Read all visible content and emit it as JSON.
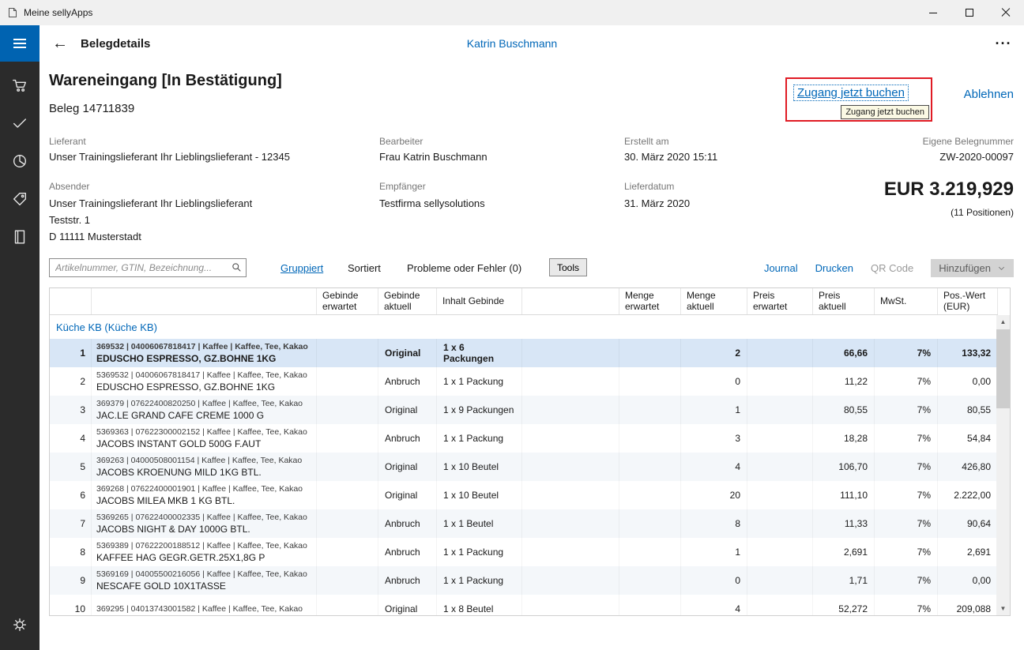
{
  "colors": {
    "accent_blue": "#0067b8",
    "hamburger_bg": "#0063b1",
    "sidebar_bg": "#2b2b2b",
    "selected_row_bg": "#d8e6f6",
    "highlight_border_red": "#e01b24"
  },
  "window": {
    "title": "Meine sellyApps"
  },
  "icons": {
    "back": "←",
    "more": "···",
    "scroll_up": "▲",
    "scroll_down": "▼"
  },
  "header": {
    "title": "Belegdetails",
    "user": "Katrin Buschmann"
  },
  "document": {
    "status_title": "Wareneingang [In Bestätigung]",
    "beleg": "Beleg 14711839",
    "actions": {
      "book_now": "Zugang jetzt buchen",
      "book_now_tooltip": "Zugang jetzt buchen",
      "reject": "Ablehnen"
    },
    "info": {
      "lieferant_label": "Lieferant",
      "lieferant": "Unser Trainingslieferant Ihr Lieblingslieferant - 12345",
      "bearbeiter_label": "Bearbeiter",
      "bearbeiter": "Frau Katrin Buschmann",
      "erstellt_label": "Erstellt am",
      "erstellt": "30. März 2020 15:11",
      "belegnummer_label": "Eigene Belegnummer",
      "belegnummer": "ZW-2020-00097",
      "absender_label": "Absender",
      "absender_lines": [
        "Unser Trainingslieferant Ihr Lieblingslieferant",
        "Teststr. 1",
        "D 11111 Musterstadt"
      ],
      "empfaenger_label": "Empfänger",
      "empfaenger": "Testfirma sellysolutions",
      "lieferdatum_label": "Lieferdatum",
      "lieferdatum": "31. März 2020"
    },
    "total": {
      "amount": "EUR 3.219,929",
      "positions": "(11 Positionen)"
    }
  },
  "toolbar": {
    "search_placeholder": "Artikelnummer, GTIN, Bezeichnung...",
    "grouped": "Gruppiert",
    "sorted": "Sortiert",
    "problems": "Probleme oder Fehler (0)",
    "tools": "Tools",
    "journal": "Journal",
    "print": "Drucken",
    "qr_code": "QR Code",
    "add": "Hinzufügen"
  },
  "table": {
    "headers": [
      "",
      "",
      "Gebinde erwartet",
      "Gebinde aktuell",
      "Inhalt Gebinde",
      "",
      "Menge erwartet",
      "Menge aktuell",
      "Preis erwartet",
      "Preis aktuell",
      "MwSt.",
      "Pos.-Wert (EUR)"
    ],
    "group": "Küche KB (Küche KB)",
    "rows": [
      {
        "num": "1",
        "meta": "369532 | 04006067818417 | Kaffee | Kaffee, Tee, Kakao",
        "name": "EDUSCHO ESPRESSO, GZ.BOHNE 1KG",
        "gebinde_aktuell": "Original",
        "inhalt": "1 x 6 Packungen",
        "menge_aktuell": "2",
        "preis_aktuell": "66,66",
        "mwst": "7%",
        "wert": "133,32",
        "selected": true
      },
      {
        "num": "2",
        "meta": "5369532 | 04006067818417 | Kaffee | Kaffee, Tee, Kakao",
        "name": "EDUSCHO ESPRESSO, GZ.BOHNE 1KG",
        "gebinde_aktuell": "Anbruch",
        "inhalt": "1 x 1 Packung",
        "menge_aktuell": "0",
        "preis_aktuell": "11,22",
        "mwst": "7%",
        "wert": "0,00"
      },
      {
        "num": "3",
        "meta": "369379 | 07622400820250 | Kaffee | Kaffee, Tee, Kakao",
        "name": "JAC.LE GRAND CAFE CREME 1000 G",
        "gebinde_aktuell": "Original",
        "inhalt": "1 x 9 Packungen",
        "menge_aktuell": "1",
        "preis_aktuell": "80,55",
        "mwst": "7%",
        "wert": "80,55"
      },
      {
        "num": "4",
        "meta": "5369363 | 07622300002152 | Kaffee | Kaffee, Tee, Kakao",
        "name": "JACOBS INSTANT GOLD 500G F.AUT",
        "gebinde_aktuell": "Anbruch",
        "inhalt": "1 x 1 Packung",
        "menge_aktuell": "3",
        "preis_aktuell": "18,28",
        "mwst": "7%",
        "wert": "54,84"
      },
      {
        "num": "5",
        "meta": "369263 | 04000508001154 | Kaffee | Kaffee, Tee, Kakao",
        "name": "JACOBS KROENUNG MILD 1KG BTL.",
        "gebinde_aktuell": "Original",
        "inhalt": "1 x 10 Beutel",
        "menge_aktuell": "4",
        "preis_aktuell": "106,70",
        "mwst": "7%",
        "wert": "426,80"
      },
      {
        "num": "6",
        "meta": "369268 | 07622400001901 | Kaffee | Kaffee, Tee, Kakao",
        "name": "JACOBS MILEA MKB 1 KG BTL.",
        "gebinde_aktuell": "Original",
        "inhalt": "1 x 10 Beutel",
        "menge_aktuell": "20",
        "preis_aktuell": "111,10",
        "mwst": "7%",
        "wert": "2.222,00"
      },
      {
        "num": "7",
        "meta": "5369265 | 07622400002335 | Kaffee | Kaffee, Tee, Kakao",
        "name": "JACOBS NIGHT & DAY 1000G BTL.",
        "gebinde_aktuell": "Anbruch",
        "inhalt": "1 x 1 Beutel",
        "menge_aktuell": "8",
        "preis_aktuell": "11,33",
        "mwst": "7%",
        "wert": "90,64"
      },
      {
        "num": "8",
        "meta": "5369389 | 07622200188512 | Kaffee | Kaffee, Tee, Kakao",
        "name": "KAFFEE HAG GEGR.GETR.25X1,8G P",
        "gebinde_aktuell": "Anbruch",
        "inhalt": "1 x 1 Packung",
        "menge_aktuell": "1",
        "preis_aktuell": "2,691",
        "mwst": "7%",
        "wert": "2,691"
      },
      {
        "num": "9",
        "meta": "5369169 | 04005500216056 | Kaffee | Kaffee, Tee, Kakao",
        "name": "NESCAFE GOLD 10X1TASSE",
        "gebinde_aktuell": "Anbruch",
        "inhalt": "1 x 1 Packung",
        "menge_aktuell": "0",
        "preis_aktuell": "1,71",
        "mwst": "7%",
        "wert": "0,00"
      },
      {
        "num": "10",
        "meta": "369295 | 04013743001582 | Kaffee | Kaffee, Tee, Kakao",
        "name": "",
        "gebinde_aktuell": "Original",
        "inhalt": "1 x 8 Beutel",
        "menge_aktuell": "4",
        "preis_aktuell": "52,272",
        "mwst": "7%",
        "wert": "209,088"
      }
    ]
  }
}
